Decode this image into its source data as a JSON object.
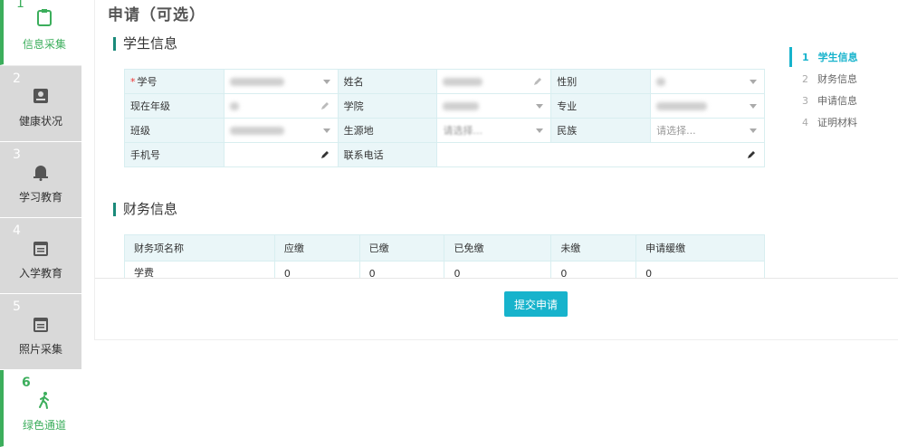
{
  "steps": [
    {
      "num": "1",
      "label": "信息采集",
      "icon": "clipboard-icon"
    },
    {
      "num": "2",
      "label": "健康状况",
      "icon": "id-card-icon"
    },
    {
      "num": "3",
      "label": "学习教育",
      "icon": "bell-icon"
    },
    {
      "num": "4",
      "label": "入学教育",
      "icon": "calendar-icon"
    },
    {
      "num": "5",
      "label": "照片采集",
      "icon": "calendar-icon"
    },
    {
      "num": "6",
      "label": "绿色通道",
      "icon": "walking-icon"
    }
  ],
  "page": {
    "title": "申请（可选）"
  },
  "student": {
    "section_title": "学生信息",
    "labels": {
      "student_id": "学号",
      "name": "姓名",
      "gender": "性别",
      "grade": "现在年级",
      "college": "学院",
      "major": "专业",
      "class": "班级",
      "origin": "生源地",
      "ethnicity": "民族",
      "mobile": "手机号",
      "phone": "联系电话"
    },
    "required_mark": "*",
    "origin_placeholder": "请选择...",
    "ethnicity_placeholder": "请选择..."
  },
  "finance": {
    "section_title": "财务信息",
    "headers": [
      "财务项名称",
      "应缴",
      "已缴",
      "已免缴",
      "未缴",
      "申请缓缴"
    ],
    "rows": [
      [
        "学费",
        "0",
        "0",
        "0",
        "0",
        "0"
      ]
    ]
  },
  "actions": {
    "submit": "提交申请"
  },
  "anchor_nav": [
    {
      "num": "1",
      "label": "学生信息"
    },
    {
      "num": "2",
      "label": "财务信息"
    },
    {
      "num": "3",
      "label": "申请信息"
    },
    {
      "num": "4",
      "label": "证明材料"
    }
  ],
  "colors": {
    "accent": "#17b3cc",
    "green": "#3cae5c",
    "section_bar": "#1a8a7a"
  }
}
